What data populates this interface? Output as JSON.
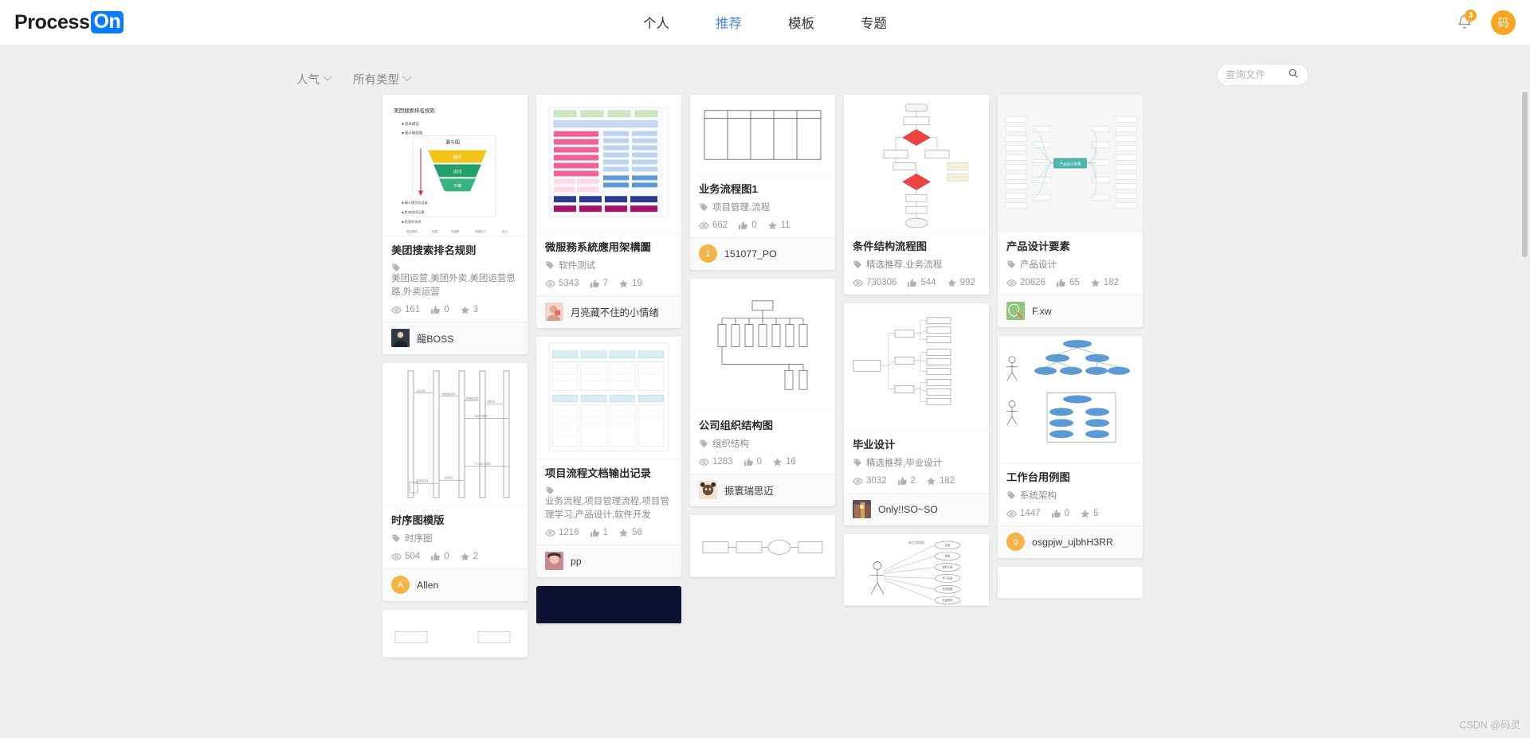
{
  "header": {
    "logo_text": "Process",
    "logo_badge": "On",
    "nav": [
      {
        "label": "个人",
        "active": false
      },
      {
        "label": "推荐",
        "active": true
      },
      {
        "label": "模板",
        "active": false
      },
      {
        "label": "专题",
        "active": false
      }
    ],
    "notification_count": "3",
    "user_avatar_text": "码",
    "accent_color": "#0a7cff",
    "active_nav_color": "#4a86e8",
    "badge_color": "#f5a623"
  },
  "toolbar": {
    "sort_filter": "人气",
    "type_filter": "所有类型",
    "search_placeholder": "查询文件",
    "search_value": ""
  },
  "cards": {
    "c1": {
      "title": "美团搜索排名规则",
      "tags": "美团运营,美团外卖,美团运营思路,外卖运营",
      "views": "161",
      "likes": "0",
      "stars": "3",
      "author": "龍BOSS",
      "avatar_text": "",
      "avatar_color": "#34404f"
    },
    "c2": {
      "title": "微服務系統應用架構圖",
      "tags": "软件测试",
      "views": "5343",
      "likes": "7",
      "stars": "19",
      "author": "月亮藏不住的小情绪",
      "avatar_text": "",
      "avatar_color": "#e8b4a8"
    },
    "c3": {
      "title": "业务流程图1",
      "tags": "项目管理,流程",
      "views": "662",
      "likes": "0",
      "stars": "11",
      "author": "151077_PO",
      "avatar_text": "1",
      "avatar_color": "#f5b44a"
    },
    "c4": {
      "title": "条件结构流程图",
      "tags": "精选推荐,业务流程",
      "views": "730306",
      "likes": "544",
      "stars": "992",
      "author": "",
      "avatar_text": "",
      "avatar_color": ""
    },
    "c5": {
      "title": "产品设计要素",
      "tags": "产品设计",
      "views": "20826",
      "likes": "65",
      "stars": "182",
      "author": "F.xw",
      "avatar_text": "",
      "avatar_color": "#8cbf8c"
    },
    "c6": {
      "title": "时序图模版",
      "tags": "时序图",
      "views": "504",
      "likes": "0",
      "stars": "2",
      "author": "Allen",
      "avatar_text": "A",
      "avatar_color": "#f5b44a"
    },
    "c7": {
      "title": "项目流程文档输出记录",
      "tags": "业务流程,项目管理流程,项目管理学习,产品设计,软件开发",
      "views": "1216",
      "likes": "1",
      "stars": "56",
      "author": "pp",
      "avatar_text": "",
      "avatar_color": "#d9a0a0"
    },
    "c8": {
      "title": "公司组织结构图",
      "tags": "组织结构",
      "views": "1283",
      "likes": "0",
      "stars": "16",
      "author": "振寰瑞思迈",
      "avatar_text": "",
      "avatar_color": "#5b4436"
    },
    "c9": {
      "title": "毕业设计",
      "tags": "精选推荐,毕业设计",
      "views": "3032",
      "likes": "2",
      "stars": "182",
      "author": "Only!!SO~SO",
      "avatar_text": "",
      "avatar_color": "#7a5c7a"
    },
    "c10": {
      "title": "工作台用例图",
      "tags": "系统架构",
      "views": "1447",
      "likes": "0",
      "stars": "5",
      "author": "osgpjw_ujbhH3RR",
      "avatar_text": "o",
      "avatar_color": "#f5b44a"
    }
  },
  "watermark": "CSDN @码灵"
}
